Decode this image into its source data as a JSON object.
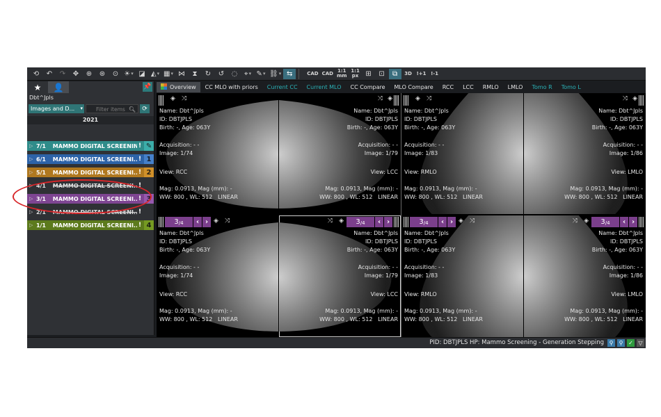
{
  "toolbar": {
    "icons": [
      "undo-all",
      "undo",
      "redo",
      "pan",
      "zoom-in",
      "zoom-fit",
      "zoom-roi",
      "window-level",
      "invert",
      "layout",
      "flip-horizontal",
      "flip-vertical",
      "rotate",
      "reset",
      "measure",
      "annotate",
      "link",
      "cursor",
      "cad",
      "cad-toggle",
      "scale-1-1-mm",
      "scale-1-1-px",
      "crosshair",
      "grid",
      "mpr",
      "3d",
      "prior-plus",
      "prior-minus"
    ],
    "labels": {
      "scale_mm_top": "1:1",
      "scale_mm_bottom": "mm",
      "scale_px_top": "1:1",
      "scale_px_bottom": "px",
      "cad": "CAD",
      "prior_plus": "+1",
      "prior_minus": "-1",
      "3d": "3D"
    }
  },
  "sidebar": {
    "patient_name": "Dbt^Jpls",
    "filter_dropdown": "Images and D...",
    "filter_placeholder": "Filter items",
    "year": "2021",
    "studies": [
      {
        "num": "7/1",
        "desc": "MAMMO DIGITAL SCREENIN...",
        "badge": "✎",
        "color": "#2f8c8a",
        "badge_color": "#3fb3b0",
        "strike": false
      },
      {
        "num": "6/1",
        "desc": "MAMMO DIGITAL SCREENI...",
        "badge": "1",
        "color": "#2d63a8",
        "badge_color": "#4a86d1",
        "strike": false
      },
      {
        "num": "5/1",
        "desc": "MAMMO DIGITAL SCREENI...",
        "badge": "2",
        "color": "#b0781f",
        "badge_color": "#d6952c",
        "strike": false
      },
      {
        "num": "4/1",
        "desc": "MAMMO DIGITAL SCREENI...",
        "badge": "",
        "color": "#2f3135",
        "badge_color": "",
        "strike": true
      },
      {
        "num": "3/1",
        "desc": "MAMMO DIGITAL SCREENI...",
        "badge": "3",
        "color": "#7e4592",
        "badge_color": "#9c5cb3",
        "strike": false
      },
      {
        "num": "2/1",
        "desc": "MAMMO DIGITAL SCREENI...",
        "badge": "",
        "color": "#2f3135",
        "badge_color": "",
        "strike": true
      },
      {
        "num": "1/1",
        "desc": "MAMMO DIGITAL SCREENI...",
        "badge": "4",
        "color": "#5c7a1c",
        "badge_color": "#7aa024",
        "strike": false
      }
    ]
  },
  "tabs": [
    {
      "label": "Overview",
      "active": true,
      "cyan": false
    },
    {
      "label": "CC MLO with priors",
      "active": false,
      "cyan": false
    },
    {
      "label": "Current CC",
      "active": false,
      "cyan": true
    },
    {
      "label": "Current MLO",
      "active": false,
      "cyan": true
    },
    {
      "label": "CC Compare",
      "active": false,
      "cyan": false
    },
    {
      "label": "MLO Compare",
      "active": false,
      "cyan": false
    },
    {
      "label": "RCC",
      "active": false,
      "cyan": false
    },
    {
      "label": "LCC",
      "active": false,
      "cyan": false
    },
    {
      "label": "RMLO",
      "active": false,
      "cyan": false
    },
    {
      "label": "LMLO",
      "active": false,
      "cyan": false
    },
    {
      "label": "Tomo R",
      "active": false,
      "cyan": true
    },
    {
      "label": "Tomo L",
      "active": false,
      "cyan": true
    }
  ],
  "viewports": [
    {
      "id": "vp1",
      "name": "Name: Dbt^Jpls",
      "pid": "ID:  DBTJPLS",
      "birth": "Birth: -, Age: 063Y",
      "acq": "Acquisition: - -",
      "image": "Image: 1/74",
      "view": "View: RCC",
      "mag": "Mag: 0.0913, Mag (mm): -",
      "wl": "WW: 800 , WL: 512",
      "lut": "LINEAR",
      "nav": false
    },
    {
      "id": "vp2",
      "name": "Name: Dbt^Jpls",
      "pid": "ID:  DBTJPLS",
      "birth": "Birth: -, Age: 063Y",
      "acq": "Acquisition: - -",
      "image": "Image: 1/79",
      "view": "View: LCC",
      "mag": "Mag: 0.0913, Mag (mm): -",
      "wl": "WW: 800 , WL: 512",
      "lut": "LINEAR",
      "nav": false
    },
    {
      "id": "vp3",
      "name": "Name: Dbt^Jpls",
      "pid": "ID:  DBTJPLS",
      "birth": "Birth: -, Age: 063Y",
      "acq": "Acquisition: - -",
      "image": "Image: 1/83",
      "view": "View: RMLO",
      "mag": "Mag: 0.0913, Mag (mm): -",
      "wl": "WW: 800 , WL: 512",
      "lut": "LINEAR",
      "nav": false
    },
    {
      "id": "vp4",
      "name": "Name: Dbt^Jpls",
      "pid": "ID:  DBTJPLS",
      "birth": "Birth: -, Age: 063Y",
      "acq": "Acquisition: - -",
      "image": "Image: 1/86",
      "view": "View: LMLO",
      "mag": "Mag: 0.0913, Mag (mm): -",
      "wl": "WW: 800 , WL: 512",
      "lut": "LINEAR",
      "nav": false
    },
    {
      "id": "vp5",
      "name": "Name: Dbt^Jpls",
      "pid": "ID:  DBTJPLS",
      "birth": "Birth: -, Age: 063Y",
      "acq": "Acquisition: - -",
      "image": "Image: 1/74",
      "view": "View: RCC",
      "mag": "Mag: 0.0913, Mag (mm): -",
      "wl": "WW: 800 , WL: 512",
      "lut": "LINEAR",
      "nav": true
    },
    {
      "id": "vp6",
      "name": "Name: Dbt^Jpls",
      "pid": "ID:  DBTJPLS",
      "birth": "Birth: -, Age: 063Y",
      "acq": "Acquisition: - -",
      "image": "Image: 1/79",
      "view": "View: LCC",
      "mag": "Mag: 0.0913, Mag (mm): -",
      "wl": "WW: 800 , WL: 512",
      "lut": "LINEAR",
      "nav": true
    },
    {
      "id": "vp7",
      "name": "Name: Dbt^Jpls",
      "pid": "ID:  DBTJPLS",
      "birth": "Birth: -, Age: 063Y",
      "acq": "Acquisition: - -",
      "image": "Image: 1/83",
      "view": "View: RMLO",
      "mag": "Mag: 0.0913, Mag (mm): -",
      "wl": "WW: 800 , WL: 512",
      "lut": "LINEAR",
      "nav": true
    },
    {
      "id": "vp8",
      "name": "Name: Dbt^Jpls",
      "pid": "ID:  DBTJPLS",
      "birth": "Birth: -, Age: 063Y",
      "acq": "Acquisition: - -",
      "image": "Image: 1/86",
      "view": "View: LMLO",
      "mag": "Mag: 0.0913, Mag (mm): -",
      "wl": "WW: 800 , WL: 512",
      "lut": "LINEAR",
      "nav": true
    }
  ],
  "slice_nav": {
    "current": "3",
    "total": "/4"
  },
  "status": {
    "text": "PID: DBTJPLS  HP: Mammo Screening - Generation Stepping"
  },
  "colors": {
    "accent": "#2f7576",
    "highlight_ring": "#d8262a",
    "nav_purple": "#7b3f8c"
  }
}
